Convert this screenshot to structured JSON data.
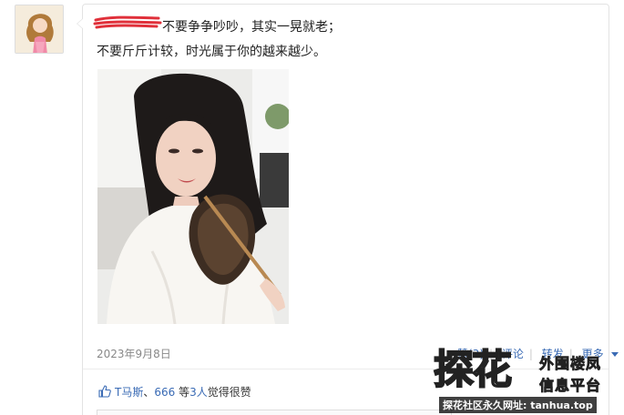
{
  "post": {
    "line1": "不要争争吵吵，其实一晃就老；",
    "line2": "不要斤斤计较，时光属于你的越来越少。",
    "date": "2023年9月8日"
  },
  "actions": {
    "like": "赞(3)",
    "comment": "评论",
    "share": "转发",
    "more": "更多"
  },
  "likes": {
    "user1": "T马斯",
    "separator": "、",
    "user2": "666",
    "mid": " 等",
    "count": "3人",
    "suffix": "觉得很赞"
  },
  "watermark": {
    "big": "探花",
    "small1": "外围楼凤",
    "small2": "信息平台",
    "url": "探花社区永久网址: tanhua.top"
  },
  "colors": {
    "link": "#3a6bb5",
    "scribble": "#e0303a"
  }
}
